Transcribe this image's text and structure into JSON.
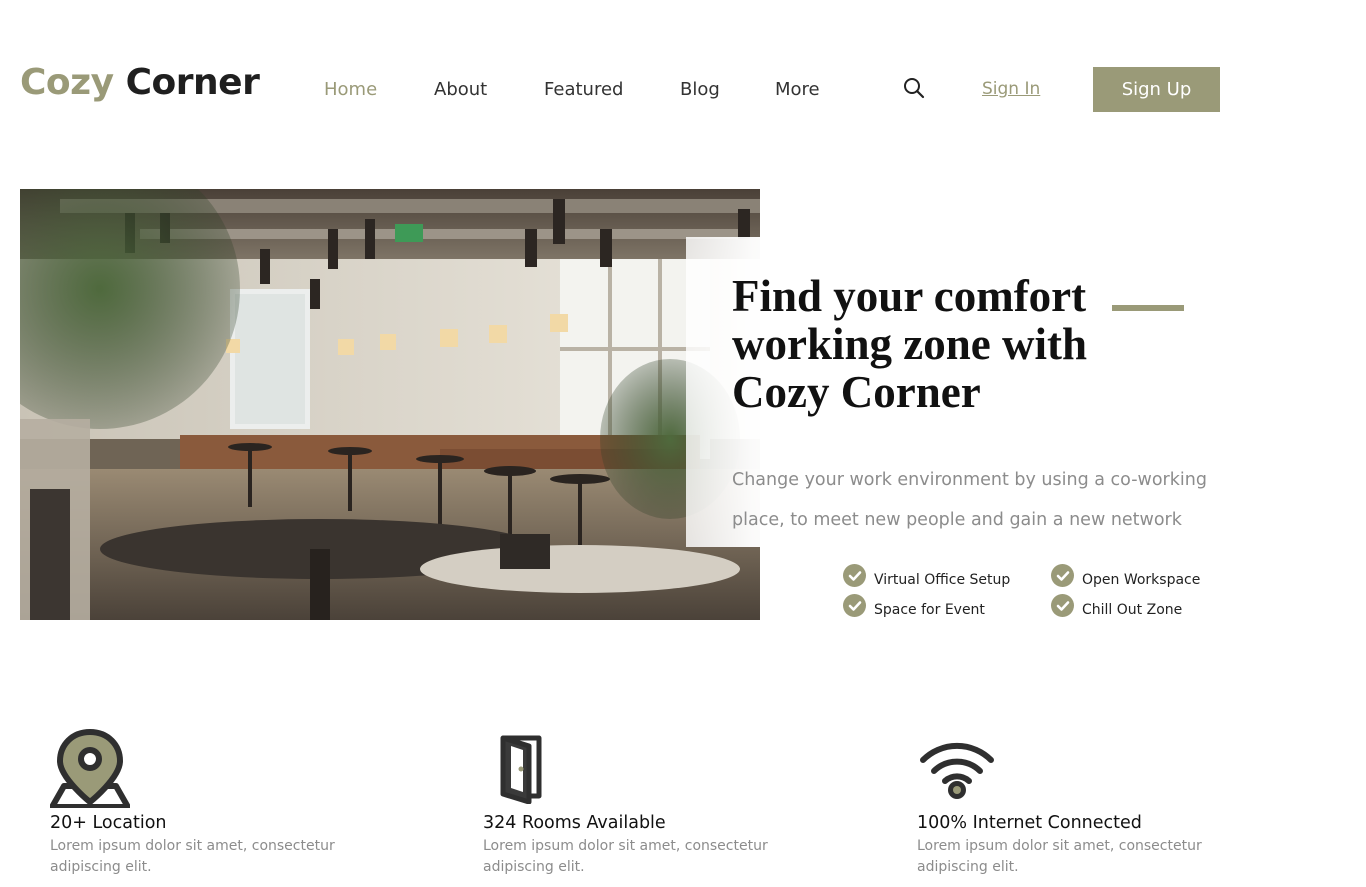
{
  "brand": {
    "part1": "Cozy",
    "part2": "Corner"
  },
  "nav": {
    "items": [
      {
        "label": "Home",
        "active": true
      },
      {
        "label": "About",
        "active": false
      },
      {
        "label": "Featured",
        "active": false
      },
      {
        "label": "Blog",
        "active": false
      },
      {
        "label": "More",
        "active": false
      }
    ]
  },
  "header": {
    "search_icon": "search-icon",
    "signin_label": "Sign In",
    "signup_label": "Sign Up"
  },
  "hero": {
    "title": "Find your comfort working zone with Cozy Corner",
    "subtitle": "Change your work environment by using a co-working place, to meet new people and gain a new network",
    "features": [
      "Virtual Office Setup",
      "Open Workspace",
      "Space for Event",
      "Chill Out Zone"
    ]
  },
  "stats": [
    {
      "icon": "location-pin-icon",
      "title": "20+ Location",
      "desc": "Lorem ipsum dolor sit amet, consectetur adipiscing elit."
    },
    {
      "icon": "door-icon",
      "title": "324 Rooms Available",
      "desc": "Lorem ipsum dolor sit amet, consectetur adipiscing elit."
    },
    {
      "icon": "wifi-icon",
      "title": "100% Internet Connected",
      "desc": "Lorem ipsum dolor sit amet, consectetur adipiscing elit."
    }
  ],
  "colors": {
    "accent": "#9a9a78",
    "text_dark": "#1f1f1f",
    "text_muted": "#8c8c8c"
  }
}
